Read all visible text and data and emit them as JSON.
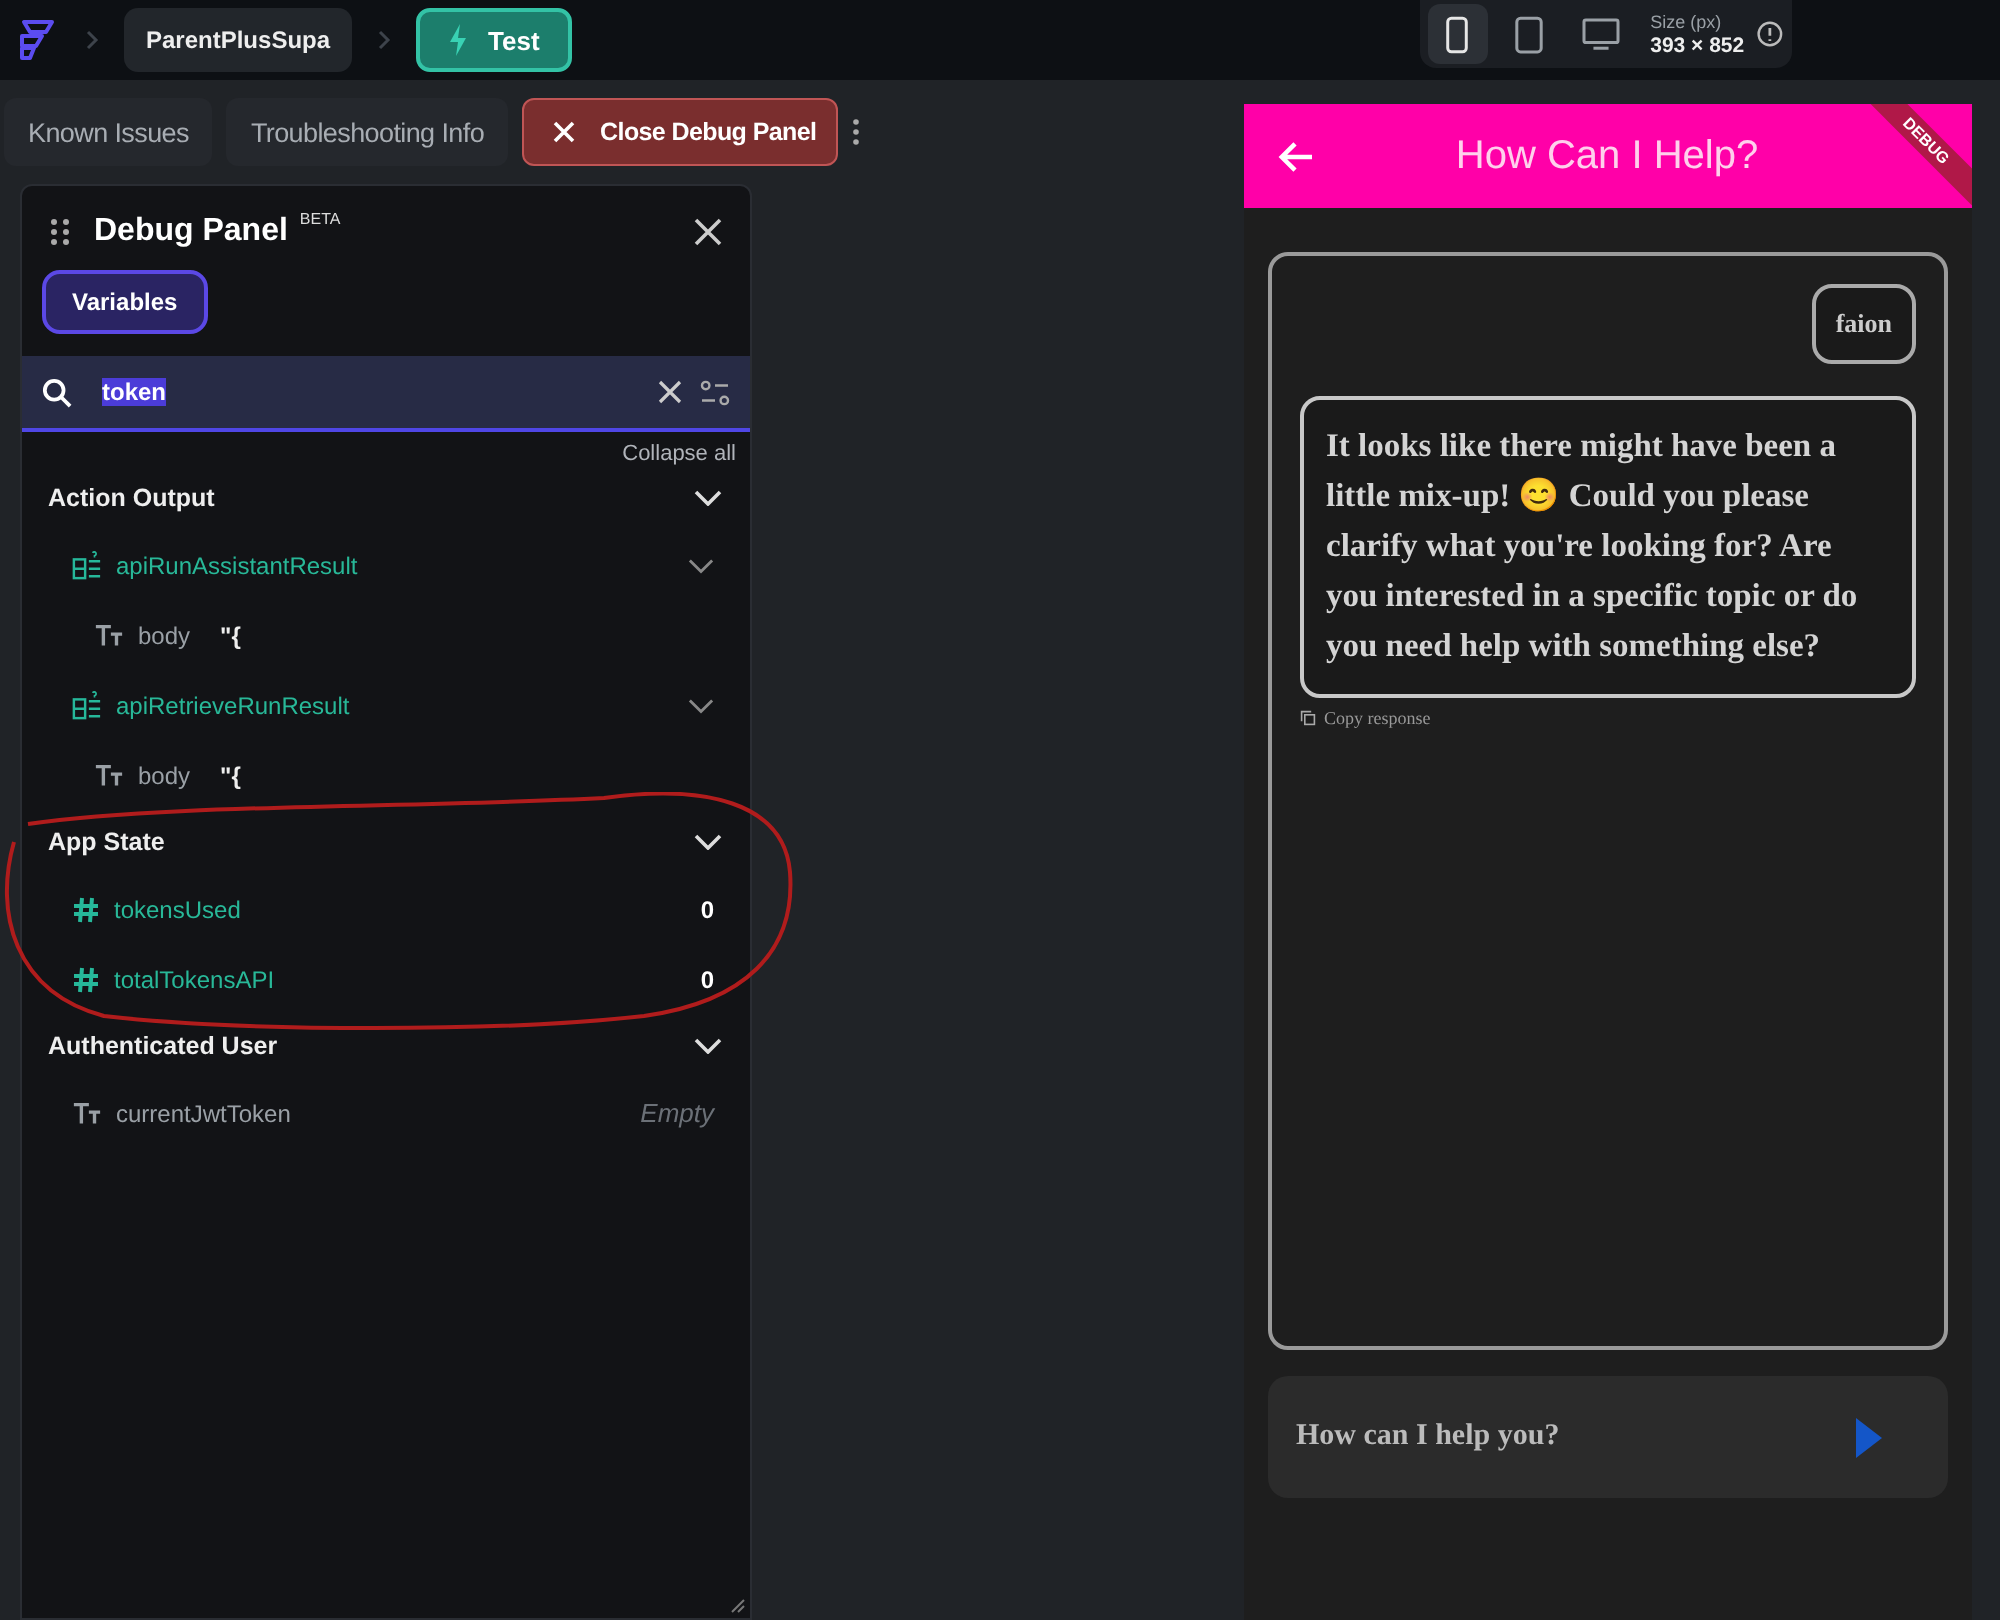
{
  "top_bar": {
    "breadcrumbs": [
      {
        "label": "ParentPlusSupa",
        "kind": "project"
      },
      {
        "label": "Test",
        "kind": "run"
      }
    ],
    "devices": [
      {
        "kind": "phone",
        "selected": true
      },
      {
        "kind": "tablet",
        "selected": false
      },
      {
        "kind": "desktop",
        "selected": false
      }
    ],
    "size_label": "Size (px)",
    "size_value": "393 × 852"
  },
  "toolbar": [
    {
      "label": "Known Issues",
      "kind": "plain"
    },
    {
      "label": "Troubleshooting Info",
      "kind": "plain"
    },
    {
      "label": "Close Debug Panel",
      "kind": "danger"
    }
  ],
  "debug_panel": {
    "title": "Debug Panel",
    "badge": "BETA",
    "tabs": [
      {
        "label": "Variables",
        "selected": true
      }
    ],
    "search": {
      "value": "token"
    },
    "collapse_all": "Collapse all",
    "sections": [
      {
        "title": "Action Output",
        "expanded": true,
        "items": [
          {
            "name": "apiRunAssistantResult",
            "kind": "struct",
            "expanded": true,
            "children": [
              {
                "name": "body",
                "kind": "text",
                "value": "\"{",
                "empty": false
              }
            ]
          },
          {
            "name": "apiRetrieveRunResult",
            "kind": "struct",
            "expanded": true,
            "children": [
              {
                "name": "body",
                "kind": "text",
                "value": "\"{",
                "empty": false
              }
            ]
          }
        ]
      },
      {
        "title": "App State",
        "expanded": true,
        "items": [
          {
            "name": "tokensUsed",
            "kind": "number",
            "value": "0",
            "empty": false
          },
          {
            "name": "totalTokensAPI",
            "kind": "number",
            "value": "0",
            "empty": false
          }
        ]
      },
      {
        "title": "Authenticated User",
        "expanded": true,
        "items": [
          {
            "name": "currentJwtToken",
            "kind": "text",
            "value": "Empty",
            "empty": true
          }
        ]
      }
    ]
  },
  "phone": {
    "title": "How Can I Help?",
    "ribbon": "DEBUG",
    "messages": [
      {
        "kind": "sent",
        "text": "faion"
      },
      {
        "kind": "reply",
        "text": "It looks like there might have been a little mix-up! 😊 Could you please clarify what you're looking for? Are you interested in a specific topic or do you need help with something else?",
        "action": "Copy response"
      }
    ],
    "input": {
      "placeholder": "How can I help you?"
    }
  }
}
